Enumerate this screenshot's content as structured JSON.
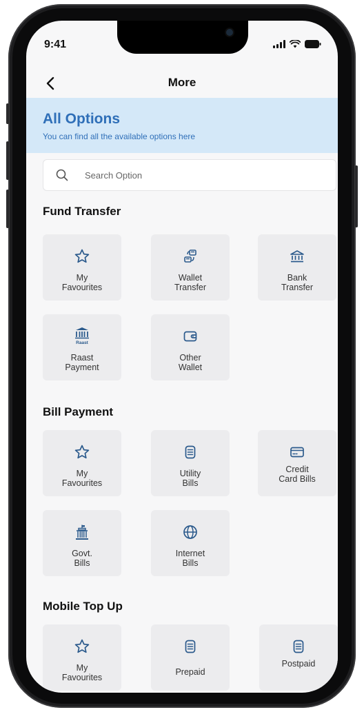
{
  "status_bar": {
    "time": "9:41"
  },
  "nav": {
    "title": "More"
  },
  "banner": {
    "title": "All Options",
    "subtitle": "You can find all the available options here"
  },
  "search": {
    "placeholder": "Search Option"
  },
  "sections": {
    "fund_transfer": {
      "title": "Fund Transfer",
      "items": [
        {
          "label": "My\nFavourites",
          "icon": "star-icon"
        },
        {
          "label": "Wallet\nTransfer",
          "icon": "wallet-transfer-icon"
        },
        {
          "label": "Bank\nTransfer",
          "icon": "bank-icon"
        },
        {
          "label": "Raast\nPayment",
          "icon": "raast-icon",
          "icon_text": "Raast"
        },
        {
          "label": "Other\nWallet",
          "icon": "wallet-icon"
        }
      ]
    },
    "bill_payment": {
      "title": "Bill Payment",
      "items": [
        {
          "label": "My\nFavourites",
          "icon": "star-icon"
        },
        {
          "label": "Utility\nBills",
          "icon": "bill-icon"
        },
        {
          "label": "Credit\nCard Bills",
          "icon": "credit-card-icon"
        },
        {
          "label": "Govt.\nBills",
          "icon": "government-building-icon"
        },
        {
          "label": "Internet\nBills",
          "icon": "globe-icon"
        }
      ]
    },
    "mobile_top_up": {
      "title": "Mobile Top Up",
      "items": [
        {
          "label": "My\nFavourites",
          "icon": "star-icon"
        },
        {
          "label": "Prepaid",
          "icon": "bill-icon"
        },
        {
          "label": "Postpaid",
          "icon": "bill-icon"
        }
      ]
    }
  },
  "colors": {
    "accent": "#2f6fb8",
    "banner_bg": "#d4e8f8",
    "tile_bg": "#ececee",
    "icon": "#2b5a8c"
  }
}
